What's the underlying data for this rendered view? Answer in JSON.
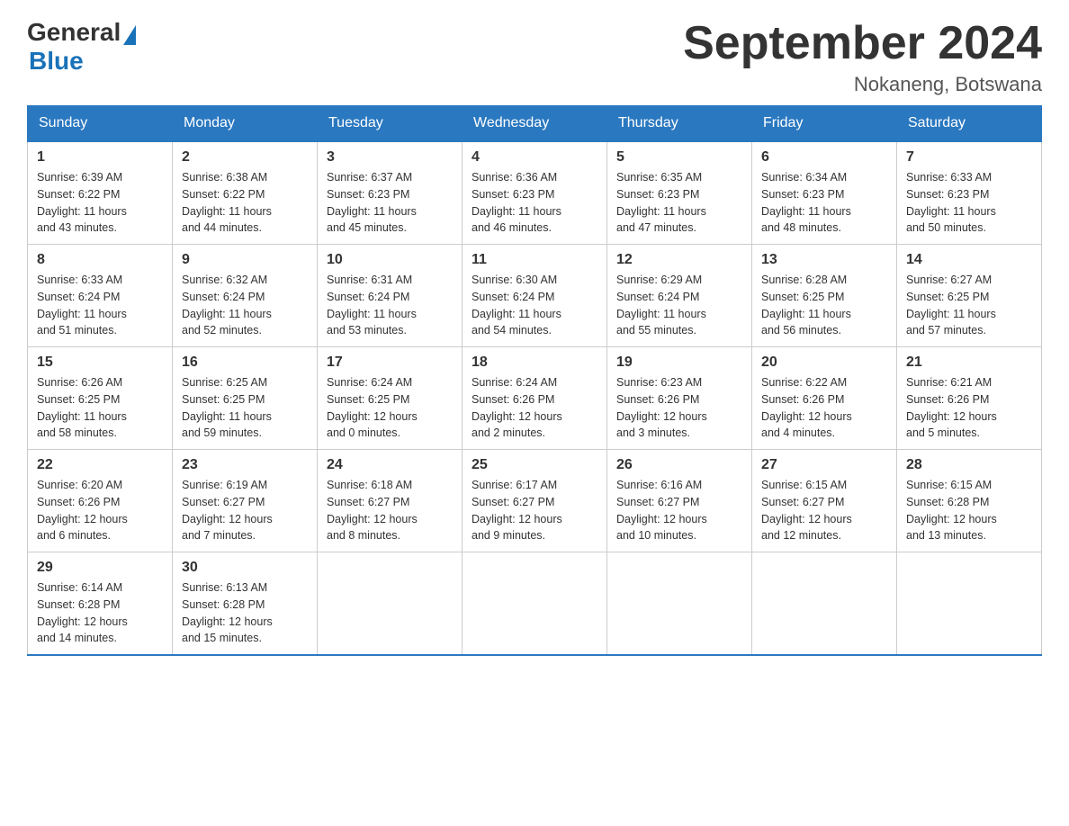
{
  "header": {
    "logo_general": "General",
    "logo_blue": "Blue",
    "month_title": "September 2024",
    "subtitle": "Nokaneng, Botswana"
  },
  "calendar": {
    "days_of_week": [
      "Sunday",
      "Monday",
      "Tuesday",
      "Wednesday",
      "Thursday",
      "Friday",
      "Saturday"
    ],
    "weeks": [
      [
        {
          "day": "1",
          "info": "Sunrise: 6:39 AM\nSunset: 6:22 PM\nDaylight: 11 hours\nand 43 minutes."
        },
        {
          "day": "2",
          "info": "Sunrise: 6:38 AM\nSunset: 6:22 PM\nDaylight: 11 hours\nand 44 minutes."
        },
        {
          "day": "3",
          "info": "Sunrise: 6:37 AM\nSunset: 6:23 PM\nDaylight: 11 hours\nand 45 minutes."
        },
        {
          "day": "4",
          "info": "Sunrise: 6:36 AM\nSunset: 6:23 PM\nDaylight: 11 hours\nand 46 minutes."
        },
        {
          "day": "5",
          "info": "Sunrise: 6:35 AM\nSunset: 6:23 PM\nDaylight: 11 hours\nand 47 minutes."
        },
        {
          "day": "6",
          "info": "Sunrise: 6:34 AM\nSunset: 6:23 PM\nDaylight: 11 hours\nand 48 minutes."
        },
        {
          "day": "7",
          "info": "Sunrise: 6:33 AM\nSunset: 6:23 PM\nDaylight: 11 hours\nand 50 minutes."
        }
      ],
      [
        {
          "day": "8",
          "info": "Sunrise: 6:33 AM\nSunset: 6:24 PM\nDaylight: 11 hours\nand 51 minutes."
        },
        {
          "day": "9",
          "info": "Sunrise: 6:32 AM\nSunset: 6:24 PM\nDaylight: 11 hours\nand 52 minutes."
        },
        {
          "day": "10",
          "info": "Sunrise: 6:31 AM\nSunset: 6:24 PM\nDaylight: 11 hours\nand 53 minutes."
        },
        {
          "day": "11",
          "info": "Sunrise: 6:30 AM\nSunset: 6:24 PM\nDaylight: 11 hours\nand 54 minutes."
        },
        {
          "day": "12",
          "info": "Sunrise: 6:29 AM\nSunset: 6:24 PM\nDaylight: 11 hours\nand 55 minutes."
        },
        {
          "day": "13",
          "info": "Sunrise: 6:28 AM\nSunset: 6:25 PM\nDaylight: 11 hours\nand 56 minutes."
        },
        {
          "day": "14",
          "info": "Sunrise: 6:27 AM\nSunset: 6:25 PM\nDaylight: 11 hours\nand 57 minutes."
        }
      ],
      [
        {
          "day": "15",
          "info": "Sunrise: 6:26 AM\nSunset: 6:25 PM\nDaylight: 11 hours\nand 58 minutes."
        },
        {
          "day": "16",
          "info": "Sunrise: 6:25 AM\nSunset: 6:25 PM\nDaylight: 11 hours\nand 59 minutes."
        },
        {
          "day": "17",
          "info": "Sunrise: 6:24 AM\nSunset: 6:25 PM\nDaylight: 12 hours\nand 0 minutes."
        },
        {
          "day": "18",
          "info": "Sunrise: 6:24 AM\nSunset: 6:26 PM\nDaylight: 12 hours\nand 2 minutes."
        },
        {
          "day": "19",
          "info": "Sunrise: 6:23 AM\nSunset: 6:26 PM\nDaylight: 12 hours\nand 3 minutes."
        },
        {
          "day": "20",
          "info": "Sunrise: 6:22 AM\nSunset: 6:26 PM\nDaylight: 12 hours\nand 4 minutes."
        },
        {
          "day": "21",
          "info": "Sunrise: 6:21 AM\nSunset: 6:26 PM\nDaylight: 12 hours\nand 5 minutes."
        }
      ],
      [
        {
          "day": "22",
          "info": "Sunrise: 6:20 AM\nSunset: 6:26 PM\nDaylight: 12 hours\nand 6 minutes."
        },
        {
          "day": "23",
          "info": "Sunrise: 6:19 AM\nSunset: 6:27 PM\nDaylight: 12 hours\nand 7 minutes."
        },
        {
          "day": "24",
          "info": "Sunrise: 6:18 AM\nSunset: 6:27 PM\nDaylight: 12 hours\nand 8 minutes."
        },
        {
          "day": "25",
          "info": "Sunrise: 6:17 AM\nSunset: 6:27 PM\nDaylight: 12 hours\nand 9 minutes."
        },
        {
          "day": "26",
          "info": "Sunrise: 6:16 AM\nSunset: 6:27 PM\nDaylight: 12 hours\nand 10 minutes."
        },
        {
          "day": "27",
          "info": "Sunrise: 6:15 AM\nSunset: 6:27 PM\nDaylight: 12 hours\nand 12 minutes."
        },
        {
          "day": "28",
          "info": "Sunrise: 6:15 AM\nSunset: 6:28 PM\nDaylight: 12 hours\nand 13 minutes."
        }
      ],
      [
        {
          "day": "29",
          "info": "Sunrise: 6:14 AM\nSunset: 6:28 PM\nDaylight: 12 hours\nand 14 minutes."
        },
        {
          "day": "30",
          "info": "Sunrise: 6:13 AM\nSunset: 6:28 PM\nDaylight: 12 hours\nand 15 minutes."
        },
        {
          "day": "",
          "info": ""
        },
        {
          "day": "",
          "info": ""
        },
        {
          "day": "",
          "info": ""
        },
        {
          "day": "",
          "info": ""
        },
        {
          "day": "",
          "info": ""
        }
      ]
    ]
  }
}
